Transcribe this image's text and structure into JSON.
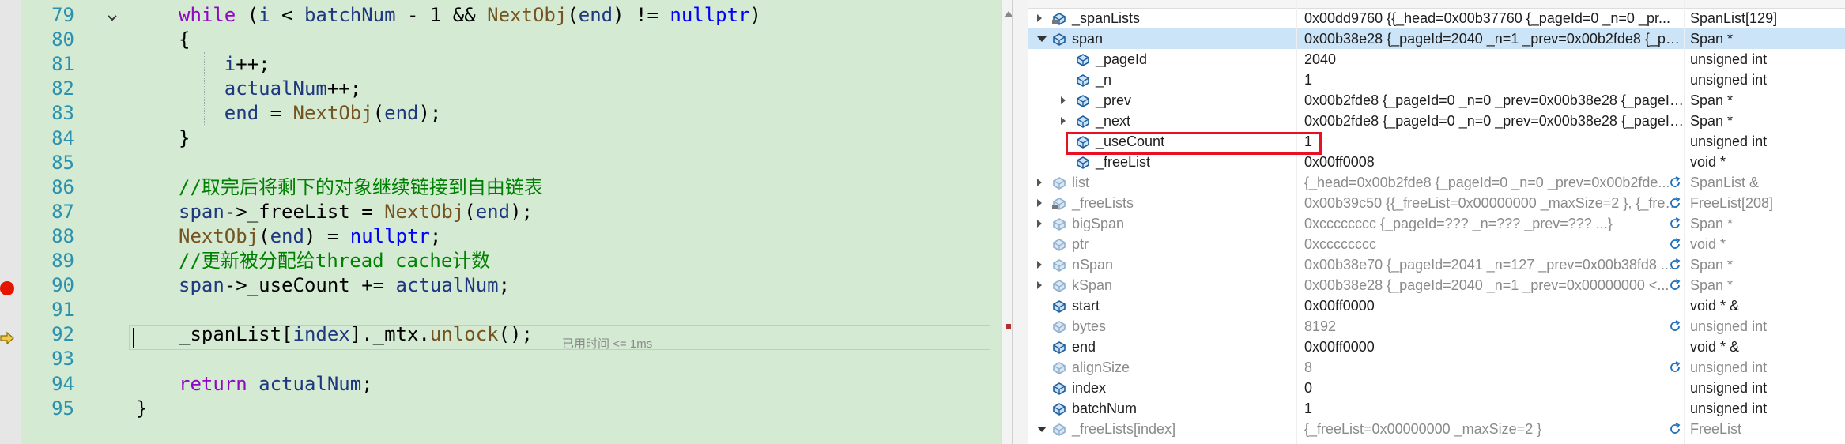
{
  "editor": {
    "lines": [
      {
        "num": "79",
        "segments": [
          [
            "ctl",
            "while"
          ],
          [
            "plain",
            " ("
          ],
          [
            "var",
            "i"
          ],
          [
            "plain",
            " < "
          ],
          [
            "var",
            "batchNum"
          ],
          [
            "plain",
            " - 1 && "
          ],
          [
            "fn",
            "NextObj"
          ],
          [
            "plain",
            "("
          ],
          [
            "var",
            "end"
          ],
          [
            "plain",
            ") != "
          ],
          [
            "kw",
            "nullptr"
          ],
          [
            "plain",
            ")"
          ]
        ]
      },
      {
        "num": "80",
        "segments": [
          [
            "plain",
            "{"
          ]
        ]
      },
      {
        "num": "81",
        "segments": [
          [
            "plain",
            "    "
          ],
          [
            "var",
            "i"
          ],
          [
            "plain",
            "++;"
          ]
        ]
      },
      {
        "num": "82",
        "segments": [
          [
            "plain",
            "    "
          ],
          [
            "var",
            "actualNum"
          ],
          [
            "plain",
            "++;"
          ]
        ]
      },
      {
        "num": "83",
        "segments": [
          [
            "plain",
            "    "
          ],
          [
            "var",
            "end"
          ],
          [
            "plain",
            " = "
          ],
          [
            "fn",
            "NextObj"
          ],
          [
            "plain",
            "("
          ],
          [
            "var",
            "end"
          ],
          [
            "plain",
            ");"
          ]
        ]
      },
      {
        "num": "84",
        "segments": [
          [
            "plain",
            "}"
          ]
        ]
      },
      {
        "num": "85",
        "segments": []
      },
      {
        "num": "86",
        "segments": [
          [
            "cm",
            "//取完后将剩下的对象继续链接到自由链表"
          ]
        ]
      },
      {
        "num": "87",
        "segments": [
          [
            "var",
            "span"
          ],
          [
            "plain",
            "->"
          ],
          [
            "field",
            "_freeList"
          ],
          [
            "plain",
            " = "
          ],
          [
            "fn",
            "NextObj"
          ],
          [
            "plain",
            "("
          ],
          [
            "var",
            "end"
          ],
          [
            "plain",
            ");"
          ]
        ]
      },
      {
        "num": "88",
        "segments": [
          [
            "fn",
            "NextObj"
          ],
          [
            "plain",
            "("
          ],
          [
            "var",
            "end"
          ],
          [
            "plain",
            ") = "
          ],
          [
            "kw",
            "nullptr"
          ],
          [
            "plain",
            ";"
          ]
        ]
      },
      {
        "num": "89",
        "segments": [
          [
            "cm",
            "//更新被分配给thread cache计数"
          ]
        ]
      },
      {
        "num": "90",
        "segments": [
          [
            "var",
            "span"
          ],
          [
            "plain",
            "->"
          ],
          [
            "field",
            "_useCount"
          ],
          [
            "plain",
            " += "
          ],
          [
            "var",
            "actualNum"
          ],
          [
            "plain",
            ";"
          ]
        ]
      },
      {
        "num": "91",
        "segments": []
      },
      {
        "num": "92",
        "segments": [
          [
            "field",
            "_spanList"
          ],
          [
            "plain",
            "["
          ],
          [
            "var",
            "index"
          ],
          [
            "plain",
            "]."
          ],
          [
            "field",
            "_mtx"
          ],
          [
            "plain",
            "."
          ],
          [
            "fn",
            "unlock"
          ],
          [
            "plain",
            "();"
          ]
        ]
      },
      {
        "num": "93",
        "segments": []
      },
      {
        "num": "94",
        "segments": [
          [
            "ctl",
            "return"
          ],
          [
            "plain",
            " "
          ],
          [
            "var",
            "actualNum"
          ],
          [
            "plain",
            ";"
          ]
        ]
      },
      {
        "num": "95",
        "segments": [
          [
            "plain",
            "}"
          ]
        ]
      }
    ],
    "elapsed_hint": "已用时间 <= 1ms",
    "current_line": "92",
    "breakpoint_line": "90"
  },
  "watch": {
    "rows": [
      {
        "name": "_spanLists",
        "value": "0x00dd9760 {{_head=0x00b37760 {_pageId=0 _n=0 _pr...",
        "type": "SpanList[129]",
        "indent": 0,
        "exp": "collapsed",
        "icon": "field-lock",
        "dim": false,
        "refresh": false
      },
      {
        "name": "span",
        "value": "0x00b38e28 {_pageId=2040 _n=1 _prev=0x00b2fde8 {_pag...",
        "type": "Span *",
        "indent": 0,
        "exp": "expanded",
        "icon": "field",
        "dim": false,
        "refresh": false,
        "selected": true
      },
      {
        "name": "_pageId",
        "value": "2040",
        "type": "unsigned int",
        "indent": 1,
        "exp": "none",
        "icon": "field",
        "dim": false,
        "refresh": false
      },
      {
        "name": "_n",
        "value": "1",
        "type": "unsigned int",
        "indent": 1,
        "exp": "none",
        "icon": "field",
        "dim": false,
        "refresh": false
      },
      {
        "name": "_prev",
        "value": "0x00b2fde8 {_pageId=0 _n=0 _prev=0x00b38e28 {_pageId...",
        "type": "Span *",
        "indent": 1,
        "exp": "collapsed",
        "icon": "field",
        "dim": false,
        "refresh": false
      },
      {
        "name": "_next",
        "value": "0x00b2fde8 {_pageId=0 _n=0 _prev=0x00b38e28 {_pageId...",
        "type": "Span *",
        "indent": 1,
        "exp": "collapsed",
        "icon": "field",
        "dim": false,
        "refresh": false
      },
      {
        "name": "_useCount",
        "value": "1",
        "type": "unsigned int",
        "indent": 1,
        "exp": "none",
        "icon": "field",
        "dim": false,
        "refresh": false
      },
      {
        "name": "_freeList",
        "value": "0x00ff0008",
        "type": "void *",
        "indent": 1,
        "exp": "none",
        "icon": "field",
        "dim": false,
        "refresh": false
      },
      {
        "name": "list",
        "value": "{_head=0x00b2fde8 {_pageId=0 _n=0 _prev=0x00b2fde...",
        "type": "SpanList &",
        "indent": 0,
        "exp": "collapsed",
        "icon": "field",
        "dim": true,
        "refresh": true
      },
      {
        "name": "_freeLists",
        "value": "0x00b39c50 {{_freeList=0x00000000 _maxSize=2 }, {_free...",
        "type": "FreeList[208]",
        "indent": 0,
        "exp": "collapsed",
        "icon": "field-lock",
        "dim": true,
        "refresh": true
      },
      {
        "name": "bigSpan",
        "value": "0xcccccccc {_pageId=??? _n=??? _prev=??? ...}",
        "type": "Span *",
        "indent": 0,
        "exp": "collapsed",
        "icon": "field",
        "dim": true,
        "refresh": true
      },
      {
        "name": "ptr",
        "value": "0xcccccccc",
        "type": "void *",
        "indent": 0,
        "exp": "none",
        "icon": "field",
        "dim": true,
        "refresh": true
      },
      {
        "name": "nSpan",
        "value": "0x00b38e70 {_pageId=2041 _n=127 _prev=0x00b38fd8 ...",
        "type": "Span *",
        "indent": 0,
        "exp": "collapsed",
        "icon": "field",
        "dim": true,
        "refresh": true
      },
      {
        "name": "kSpan",
        "value": "0x00b38e28 {_pageId=2040 _n=1 _prev=0x00000000 <...",
        "type": "Span *",
        "indent": 0,
        "exp": "collapsed",
        "icon": "field",
        "dim": true,
        "refresh": true
      },
      {
        "name": "start",
        "value": "0x00ff0000",
        "type": "void * &",
        "indent": 0,
        "exp": "none",
        "icon": "field",
        "dim": false,
        "refresh": false
      },
      {
        "name": "bytes",
        "value": "8192",
        "type": "unsigned int",
        "indent": 0,
        "exp": "none",
        "icon": "field",
        "dim": true,
        "refresh": true
      },
      {
        "name": "end",
        "value": "0x00ff0000",
        "type": "void * &",
        "indent": 0,
        "exp": "none",
        "icon": "field",
        "dim": false,
        "refresh": false
      },
      {
        "name": "alignSize",
        "value": "8",
        "type": "unsigned int",
        "indent": 0,
        "exp": "none",
        "icon": "field",
        "dim": true,
        "refresh": true
      },
      {
        "name": "index",
        "value": "0",
        "type": "unsigned int",
        "indent": 0,
        "exp": "none",
        "icon": "field",
        "dim": false,
        "refresh": false
      },
      {
        "name": "batchNum",
        "value": "1",
        "type": "unsigned int",
        "indent": 0,
        "exp": "none",
        "icon": "field",
        "dim": false,
        "refresh": false
      },
      {
        "name": "_freeLists[index]",
        "value": "{_freeList=0x00000000 _maxSize=2 }",
        "type": "FreeList",
        "indent": 0,
        "exp": "expanded",
        "icon": "field",
        "dim": true,
        "refresh": true
      }
    ]
  },
  "colors": {
    "editor_bg": "#d4ead3",
    "selected_row": "#cce4f7",
    "highlight_box": "#e81123",
    "breakpoint": "#e51400",
    "exec_arrow": "#f2c94c"
  }
}
